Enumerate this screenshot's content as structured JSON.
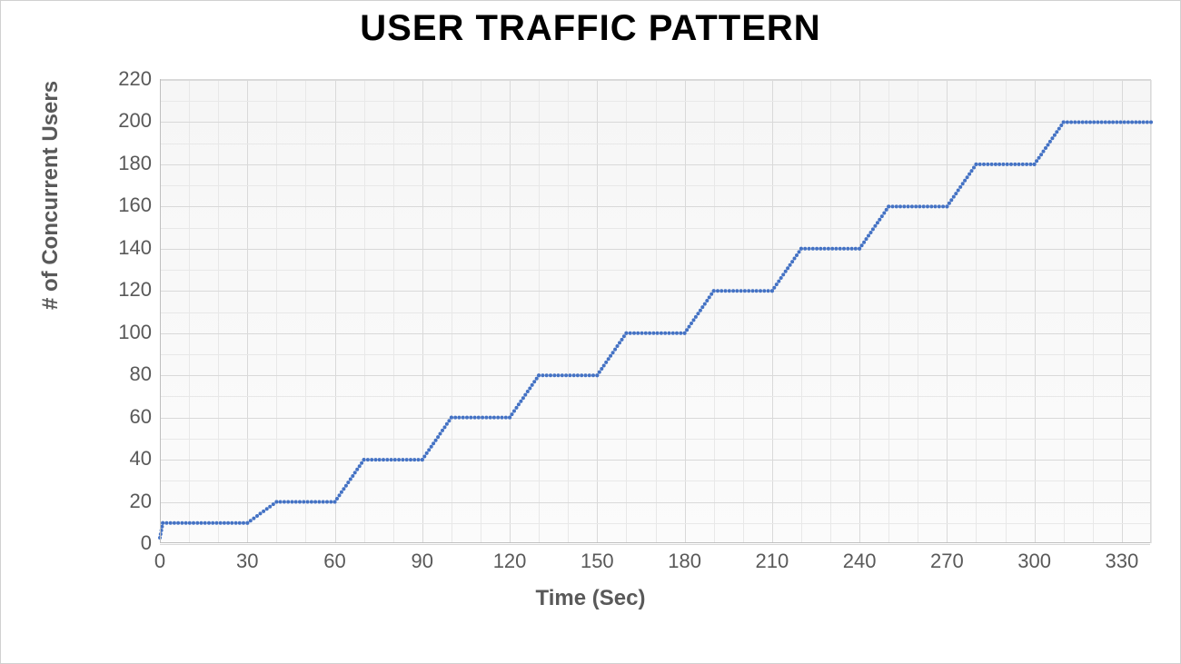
{
  "chart_data": {
    "type": "line",
    "title": "USER TRAFFIC PATTERN",
    "xlabel": "Time (Sec)",
    "ylabel": "# of Concurrent Users",
    "xlim": [
      0,
      340
    ],
    "ylim": [
      0,
      220
    ],
    "x_ticks": [
      0,
      30,
      60,
      90,
      120,
      150,
      180,
      210,
      240,
      270,
      300,
      330
    ],
    "y_ticks": [
      0,
      20,
      40,
      60,
      80,
      100,
      120,
      140,
      160,
      180,
      200,
      220
    ],
    "x_minor_step": 10,
    "y_minor_step": 10,
    "series": [
      {
        "name": "Concurrent Users",
        "color": "#4472C4",
        "style": "dotted",
        "points": [
          [
            0,
            3
          ],
          [
            1,
            10
          ],
          [
            30,
            10
          ],
          [
            40,
            20
          ],
          [
            60,
            20
          ],
          [
            70,
            40
          ],
          [
            90,
            40
          ],
          [
            100,
            60
          ],
          [
            120,
            60
          ],
          [
            130,
            80
          ],
          [
            150,
            80
          ],
          [
            160,
            100
          ],
          [
            180,
            100
          ],
          [
            190,
            120
          ],
          [
            210,
            120
          ],
          [
            220,
            140
          ],
          [
            240,
            140
          ],
          [
            250,
            160
          ],
          [
            270,
            160
          ],
          [
            280,
            180
          ],
          [
            300,
            180
          ],
          [
            310,
            200
          ],
          [
            340,
            200
          ]
        ]
      }
    ]
  }
}
